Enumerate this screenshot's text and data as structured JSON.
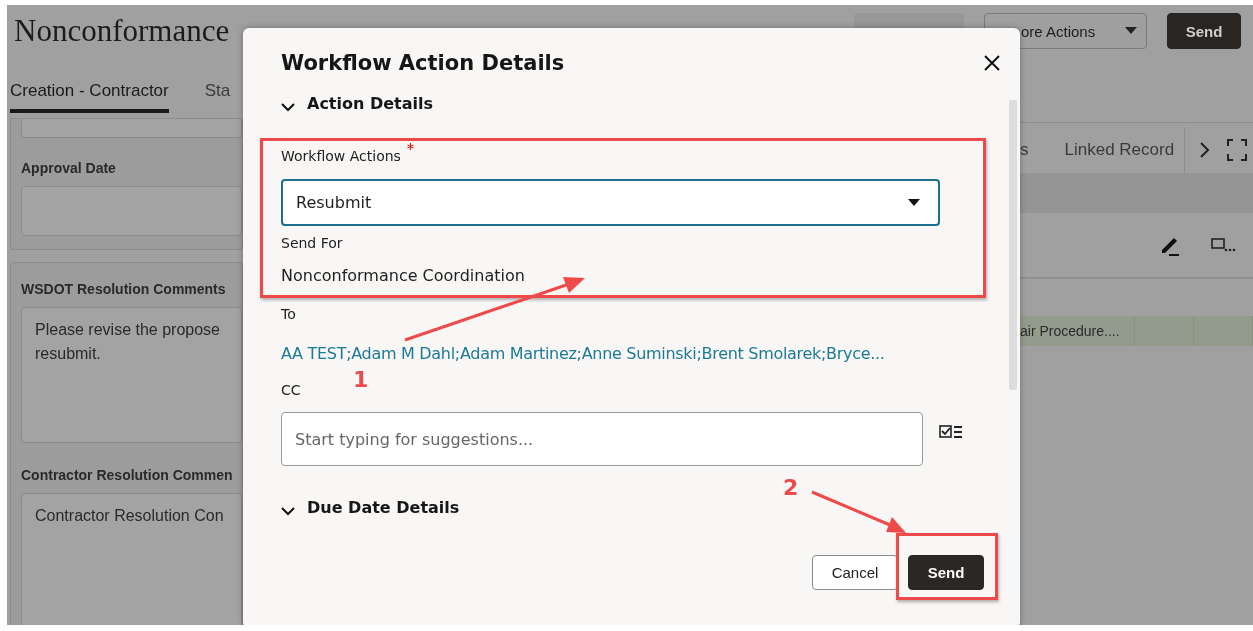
{
  "page": {
    "title": "Nonconformance",
    "header_buttons": [
      {
        "kind": "plain"
      },
      {
        "kind": "dropdown",
        "label": "ore Actions"
      },
      {
        "kind": "primary",
        "label": "Send"
      }
    ],
    "tabs": [
      {
        "label": "Creation - Contractor",
        "selected": true
      },
      {
        "label": "Sta",
        "selected": false
      }
    ],
    "left_panels": [
      {
        "fields": [
          {
            "kind": "input"
          },
          {
            "kind": "input",
            "label": "Approval Date"
          }
        ]
      },
      {
        "fields": [
          {
            "kind": "textarea",
            "label": "WSDOT Resolution Comments",
            "value": "Please revise the propose\nresubmit."
          },
          {
            "kind": "textarea",
            "label": "Contractor Resolution Commen",
            "value": "Contractor Resolution Con"
          }
        ]
      }
    ],
    "right_tabs": [
      {
        "label": "s"
      },
      {
        "label": "Linked Record"
      }
    ],
    "row_cells": [
      "air Procedure...."
    ]
  },
  "dialog": {
    "title": "Workflow Action Details",
    "action_section": {
      "title": "Action Details"
    },
    "workflow_actions": {
      "label": "Workflow Actions",
      "required": true,
      "value": "Resubmit"
    },
    "send_for": {
      "label": "Send For",
      "value": "Nonconformance Coordination"
    },
    "to": {
      "label": "To",
      "value": "AA TEST;Adam M Dahl;Adam Martinez;Anne Suminski;Brent Smolarek;Bryce..."
    },
    "cc": {
      "label": "CC",
      "placeholder": "Start typing for suggestions..."
    },
    "due_section": {
      "title": "Due Date Details"
    },
    "buttons": [
      {
        "kind": "secondary",
        "label": "Cancel"
      },
      {
        "kind": "primary",
        "label": "Send"
      }
    ]
  },
  "annotations": [
    {
      "label": "1"
    },
    {
      "label": "2"
    }
  ]
}
